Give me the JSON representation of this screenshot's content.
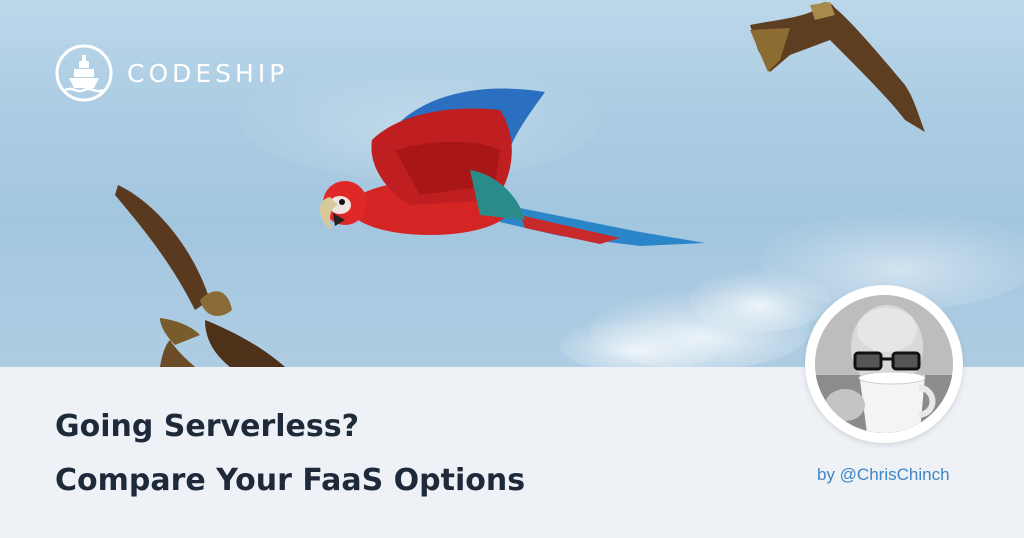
{
  "brand": {
    "name": "CODESHIP",
    "logo_icon": "ship-icon"
  },
  "article": {
    "title_line1": "Going Serverless?",
    "title_line2": "Compare Your FaaS Options",
    "byline": "by @ChrisChinch"
  },
  "colors": {
    "title_text": "#1e2a3a",
    "byline_text": "#3f86c6",
    "footer_bg": "#eef1f6",
    "sky": "#a9cbe2"
  },
  "images": {
    "hero": "parrot-and-kites-photo",
    "avatar": "author-photo"
  }
}
